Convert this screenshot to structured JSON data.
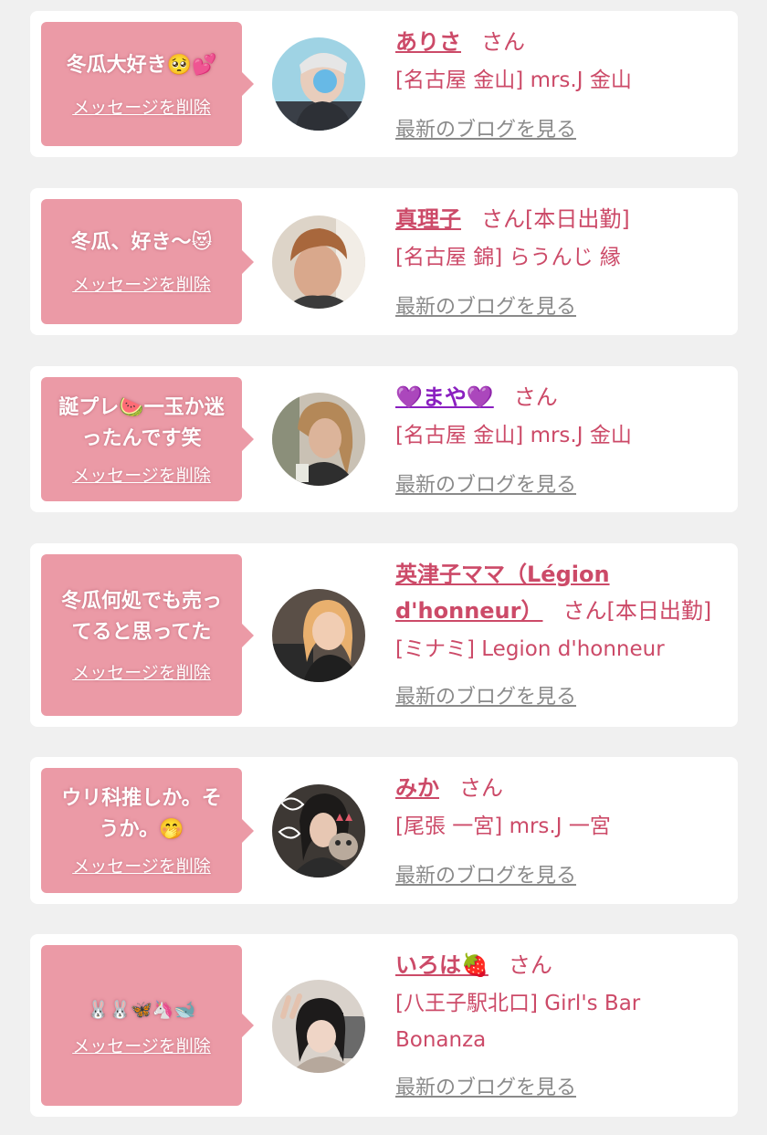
{
  "delete_label": "メッセージを削除",
  "blog_label": "最新のブログを見る",
  "san_label": "さん",
  "colors": {
    "bubble": "#eb9aa6",
    "name": "#cc4a68",
    "link_gray": "#8a8a8a",
    "background": "#f0f0f0"
  },
  "items": [
    {
      "message_line1": "冬瓜大好き🥺💕",
      "message_line2": "",
      "name": "ありさ",
      "status": "",
      "shop_line1": "[名古屋 金山] mrs.J 金山",
      "shop_line2": ""
    },
    {
      "message_line1": "冬瓜、好き〜😻",
      "message_line2": "",
      "name": "真理子",
      "status": "[本日出勤]",
      "shop_line1": "[名古屋 錦] らうんじ 縁",
      "shop_line2": ""
    },
    {
      "message_line1": "誕プレ🍉一玉か迷",
      "message_line2": "ったんです笑",
      "name": "💜まや💜",
      "status": "",
      "shop_line1": "[名古屋 金山] mrs.J 金山",
      "shop_line2": ""
    },
    {
      "message_line1": "冬瓜何処でも売っ",
      "message_line2": "てると思ってた",
      "name_line1": "英津子ママ（Légion",
      "name_line2": "d'honneur）",
      "status": "[本日出勤]",
      "shop_line1": "[ミナミ] Legion d'honneur",
      "shop_line2": ""
    },
    {
      "message_line1": "ウリ科推しか。そ",
      "message_line2": "うか。🤭",
      "name": "みか",
      "status": "",
      "shop_line1": "[尾張 一宮] mrs.J 一宮",
      "shop_line2": ""
    },
    {
      "message_line1": "🐰🐰🦋🦄🐋",
      "message_line2": "",
      "name": "いろは🍓",
      "status": "",
      "shop_line1": "[八王子駅北口] Girl's Bar",
      "shop_line2": "Bonanza"
    }
  ]
}
